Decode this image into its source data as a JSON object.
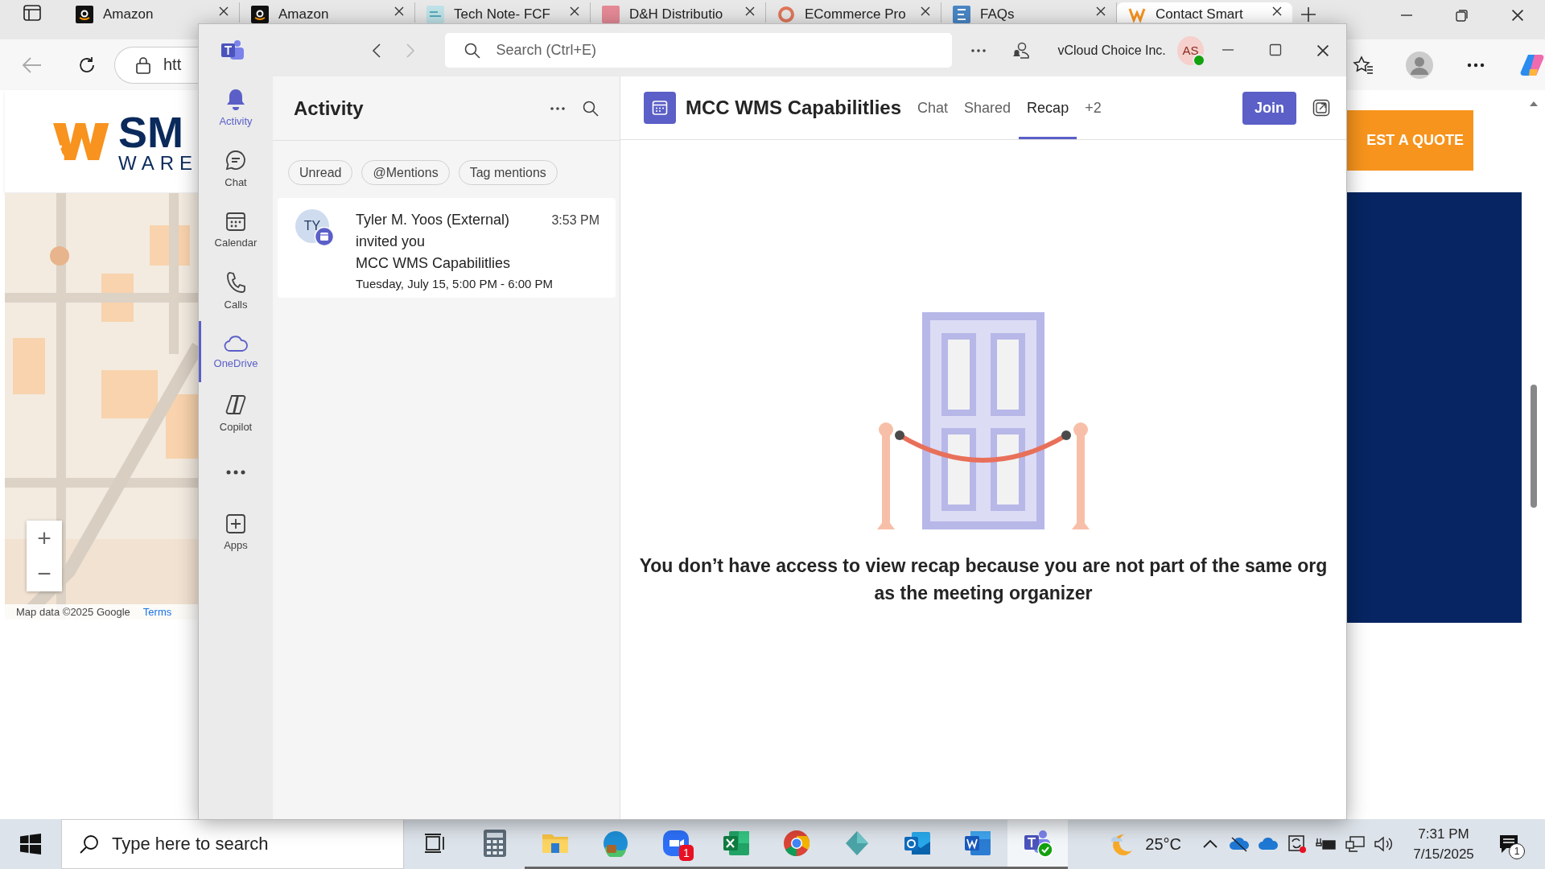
{
  "browser": {
    "tabs": [
      {
        "title": "Amazon",
        "kind": "amazon",
        "selected": false
      },
      {
        "title": "Amazon",
        "kind": "amazon",
        "selected": false
      },
      {
        "title": "Tech Note- FCF",
        "kind": "note",
        "selected": false
      },
      {
        "title": "D&H Distributio",
        "kind": "square",
        "selected": false
      },
      {
        "title": "ECommerce Pro",
        "kind": "ring",
        "selected": false
      },
      {
        "title": "FAQs",
        "kind": "faq",
        "selected": false
      },
      {
        "title": "Contact Smart",
        "kind": "w",
        "selected": true
      }
    ],
    "address": "htt",
    "page": {
      "logo_text": "SM",
      "logo_subtext": "WARE",
      "zoom_in": "+",
      "zoom_out": "−",
      "map_attribution": "Map data ©2025 Google",
      "map_terms": "Terms",
      "quote_button": "EST A QUOTE"
    }
  },
  "teams": {
    "nav": {
      "back_disabled": false,
      "forward_disabled": true
    },
    "search": {
      "placeholder": "Search (Ctrl+E)"
    },
    "org": "vCloud Choice Inc.",
    "avatar": "AS",
    "rail": [
      {
        "label": "Activity",
        "kind": "bell",
        "highlighted": true,
        "selected": false
      },
      {
        "label": "Chat",
        "kind": "chat",
        "highlighted": false,
        "selected": false
      },
      {
        "label": "Calendar",
        "kind": "calendar",
        "highlighted": false,
        "selected": false
      },
      {
        "label": "Calls",
        "kind": "phone",
        "highlighted": false,
        "selected": false
      },
      {
        "label": "OneDrive",
        "kind": "cloud",
        "highlighted": true,
        "selected": true
      },
      {
        "label": "Copilot",
        "kind": "copilot",
        "highlighted": false,
        "selected": false
      },
      {
        "kind": "more"
      },
      {
        "label": "Apps",
        "kind": "apps",
        "highlighted": false,
        "selected": false
      }
    ],
    "activity": {
      "title": "Activity",
      "filters": [
        {
          "label": "Unread",
          "selected": false
        },
        {
          "label": "@Mentions",
          "selected": false
        },
        {
          "label": "Tag mentions",
          "selected": false
        }
      ],
      "items": [
        {
          "avatar": "TY",
          "sender": "Tyler M. Yoos (External)",
          "time": "3:53 PM",
          "action": "invited you",
          "subject": "MCC WMS Capabilitlies",
          "when": "Tuesday, July 15, 5:00 PM - 6:00 PM"
        }
      ]
    },
    "meeting": {
      "title": "MCC WMS Capabilitlies",
      "tabs": [
        {
          "label": "Chat",
          "selected": false
        },
        {
          "label": "Shared",
          "selected": false
        },
        {
          "label": "Recap",
          "selected": true
        },
        {
          "label": "+2",
          "selected": false
        }
      ],
      "join": "Join",
      "message": "You don’t have access to view recap because you are not part of the same org as the meeting organizer"
    }
  },
  "taskbar": {
    "search": {
      "placeholder": "Type here to search"
    },
    "apps": [
      {
        "kind": "taskview",
        "running": false,
        "active": false
      },
      {
        "kind": "calculator",
        "running": false,
        "active": false
      },
      {
        "kind": "explorer",
        "running": true,
        "active": false
      },
      {
        "kind": "edge",
        "running": true,
        "active": false
      },
      {
        "kind": "zoom",
        "running": true,
        "active": false,
        "badge": "1"
      },
      {
        "kind": "excel",
        "running": true,
        "active": false
      },
      {
        "kind": "chrome",
        "running": true,
        "active": false
      },
      {
        "kind": "diamond",
        "running": true,
        "active": false
      },
      {
        "kind": "outlook",
        "running": true,
        "active": false
      },
      {
        "kind": "word",
        "running": true,
        "active": false
      },
      {
        "kind": "teams",
        "running": true,
        "active": true
      }
    ],
    "weather": "25°C",
    "time": "7:31 PM",
    "date": "7/15/2025",
    "notifications": "1"
  }
}
